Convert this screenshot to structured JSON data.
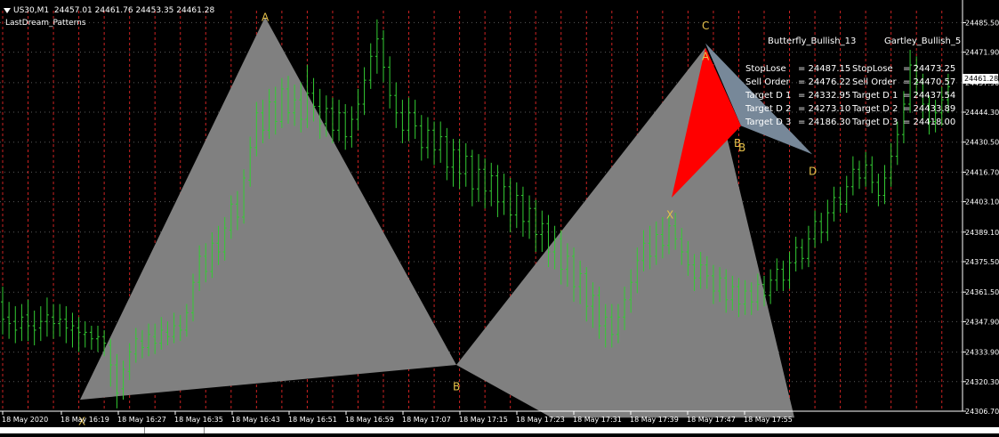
{
  "header": {
    "symbol": "US30,M1",
    "ohlc": "24457.01 24461.76 24453.35 24461.28",
    "indicator": "LastDream_Patterns"
  },
  "colors": {
    "background": "#000000",
    "candles": "#33cc33",
    "pattern_grey": "#808080",
    "pattern_red": "#ff0000",
    "pattern_slate": "#778899",
    "labels": "#e6c14a",
    "grid_v": "#cc2222",
    "grid_h": "#5a5a5a",
    "axis_text": "#ffffff"
  },
  "current_price_label": "24461.28",
  "panel": {
    "title_left": "Butterfly_Bullish_13",
    "title_right": "Gartley_Bullish_5",
    "rows": [
      {
        "l_label": "StopLose",
        "l_val": "= 24487.15",
        "r_label": "StopLose",
        "r_val": "= 24473.25"
      },
      {
        "l_label": "Sell Order",
        "l_val": "= 24476.22",
        "r_label": "Sell Order",
        "r_val": "= 24470.57"
      },
      {
        "l_label": "Target D 1",
        "l_val": "= 24332.95",
        "r_label": "Target D 1",
        "r_val": "= 24437.54"
      },
      {
        "l_label": "Target D 2",
        "l_val": "= 24273.10",
        "r_label": "Target D 2",
        "r_val": "= 24433.89"
      },
      {
        "l_label": "Target D 3",
        "l_val": "= 24186.30",
        "r_label": "Target D 3",
        "r_val": "= 24418.00"
      }
    ]
  },
  "chart_data": {
    "type": "candlestick",
    "symbol": "US30,M1",
    "ylim": [
      24306.7,
      24491.0
    ],
    "y_ticks": [
      "24485.50",
      "24471.90",
      "24457.90",
      "24444.30",
      "24430.50",
      "24416.70",
      "24403.10",
      "24389.10",
      "24375.50",
      "24361.50",
      "24347.90",
      "24333.90",
      "24320.30",
      "24306.70"
    ],
    "x_ticks": [
      "18 May 2020",
      "18 May 16:19",
      "18 May 16:27",
      "18 May 16:35",
      "18 May 16:43",
      "18 May 16:51",
      "18 May 16:59",
      "18 May 17:07",
      "18 May 17:15",
      "18 May 17:23",
      "18 May 17:31",
      "18 May 17:39",
      "18 May 17:47",
      "18 May 17:55"
    ],
    "grid": true,
    "bars": [
      [
        24357,
        24349,
        24364,
        24342
      ],
      [
        24350,
        24347,
        24357,
        24340
      ],
      [
        24348,
        24344,
        24355,
        24338
      ],
      [
        24345,
        24350,
        24356,
        24339
      ],
      [
        24351,
        24346,
        24358,
        24339
      ],
      [
        24346,
        24344,
        24353,
        24337
      ],
      [
        24345,
        24348,
        24355,
        24339
      ],
      [
        24348,
        24351,
        24359,
        24341
      ],
      [
        24350,
        24347,
        24356,
        24340
      ],
      [
        24347,
        24349,
        24356,
        24341
      ],
      [
        24349,
        24345,
        24355,
        24338
      ],
      [
        24344,
        24346,
        24352,
        24336
      ],
      [
        24345,
        24343,
        24350,
        24334
      ],
      [
        24342,
        24343,
        24348,
        24336
      ],
      [
        24343,
        24340,
        24346,
        24335
      ],
      [
        24340,
        24341,
        24346,
        24334
      ],
      [
        24341,
        24338,
        24344,
        24332
      ],
      [
        24337,
        24328,
        24340,
        24318
      ],
      [
        24328,
        24315,
        24333,
        24308
      ],
      [
        24317,
        24326,
        24330,
        24312
      ],
      [
        24325,
        24334,
        24338,
        24321
      ],
      [
        24333,
        24340,
        24345,
        24329
      ],
      [
        24339,
        24336,
        24344,
        24331
      ],
      [
        24336,
        24342,
        24347,
        24332
      ],
      [
        24341,
        24338,
        24347,
        24333
      ],
      [
        24338,
        24344,
        24350,
        24335
      ],
      [
        24343,
        24341,
        24348,
        24337
      ],
      [
        24341,
        24346,
        24352,
        24338
      ],
      [
        24346,
        24344,
        24351,
        24339
      ],
      [
        24344,
        24352,
        24356,
        24341
      ],
      [
        24352,
        24366,
        24370,
        24348
      ],
      [
        24366,
        24378,
        24383,
        24362
      ],
      [
        24378,
        24371,
        24384,
        24366
      ],
      [
        24371,
        24384,
        24389,
        24368
      ],
      [
        24384,
        24380,
        24392,
        24374
      ],
      [
        24380,
        24391,
        24396,
        24376
      ],
      [
        24390,
        24402,
        24406,
        24386
      ],
      [
        24402,
        24396,
        24408,
        24390
      ],
      [
        24396,
        24414,
        24418,
        24393
      ],
      [
        24413,
        24428,
        24433,
        24410
      ],
      [
        24428,
        24444,
        24449,
        24424
      ],
      [
        24444,
        24436,
        24450,
        24430
      ],
      [
        24436,
        24449,
        24455,
        24432
      ],
      [
        24449,
        24440,
        24456,
        24434
      ],
      [
        24440,
        24455,
        24460,
        24437
      ],
      [
        24455,
        24444,
        24461,
        24439
      ],
      [
        24444,
        24450,
        24457,
        24438
      ],
      [
        24450,
        24441,
        24458,
        24435
      ],
      [
        24441,
        24453,
        24466,
        24437
      ],
      [
        24453,
        24447,
        24460,
        24440
      ],
      [
        24447,
        24439,
        24455,
        24432
      ],
      [
        24439,
        24446,
        24452,
        24433
      ],
      [
        24446,
        24436,
        24451,
        24430
      ],
      [
        24436,
        24444,
        24450,
        24431
      ],
      [
        24444,
        24433,
        24448,
        24427
      ],
      [
        24433,
        24441,
        24447,
        24428
      ],
      [
        24441,
        24448,
        24455,
        24436
      ],
      [
        24448,
        24459,
        24465,
        24443
      ],
      [
        24459,
        24470,
        24476,
        24455
      ],
      [
        24470,
        24478,
        24487,
        24462
      ],
      [
        24478,
        24465,
        24482,
        24458
      ],
      [
        24465,
        24452,
        24470,
        24446
      ],
      [
        24452,
        24444,
        24458,
        24437
      ],
      [
        24444,
        24436,
        24450,
        24430
      ],
      [
        24436,
        24444,
        24451,
        24431
      ],
      [
        24444,
        24438,
        24450,
        24432
      ],
      [
        24438,
        24428,
        24443,
        24422
      ],
      [
        24428,
        24436,
        24442,
        24423
      ],
      [
        24436,
        24427,
        24440,
        24420
      ],
      [
        24427,
        24433,
        24440,
        24421
      ],
      [
        24433,
        24419,
        24437,
        24413
      ],
      [
        24419,
        24427,
        24432,
        24410
      ],
      [
        24427,
        24416,
        24432,
        24409
      ],
      [
        24416,
        24424,
        24430,
        24410
      ],
      [
        24424,
        24409,
        24427,
        24401
      ],
      [
        24409,
        24418,
        24425,
        24403
      ],
      [
        24418,
        24408,
        24423,
        24400
      ],
      [
        24408,
        24415,
        24421,
        24401
      ],
      [
        24415,
        24403,
        24420,
        24396
      ],
      [
        24403,
        24410,
        24416,
        24397
      ],
      [
        24410,
        24397,
        24414,
        24389
      ],
      [
        24397,
        24406,
        24412,
        24391
      ],
      [
        24406,
        24394,
        24410,
        24387
      ],
      [
        24394,
        24400,
        24406,
        24386
      ],
      [
        24400,
        24388,
        24404,
        24380
      ],
      [
        24388,
        24393,
        24399,
        24380
      ],
      [
        24393,
        24380,
        24397,
        24373
      ],
      [
        24380,
        24386,
        24392,
        24372
      ],
      [
        24386,
        24372,
        24390,
        24365
      ],
      [
        24372,
        24378,
        24384,
        24364
      ],
      [
        24378,
        24364,
        24382,
        24357
      ],
      [
        24364,
        24370,
        24376,
        24356
      ],
      [
        24370,
        24355,
        24373,
        24348
      ],
      [
        24355,
        24360,
        24366,
        24345
      ],
      [
        24360,
        24346,
        24364,
        24340
      ],
      [
        24346,
        24350,
        24356,
        24336
      ],
      [
        24350,
        24342,
        24356,
        24336
      ],
      [
        24342,
        24350,
        24356,
        24338
      ],
      [
        24350,
        24358,
        24364,
        24344
      ],
      [
        24358,
        24366,
        24372,
        24352
      ],
      [
        24366,
        24376,
        24382,
        24361
      ],
      [
        24376,
        24384,
        24390,
        24371
      ],
      [
        24384,
        24378,
        24392,
        24372
      ],
      [
        24378,
        24388,
        24394,
        24374
      ],
      [
        24388,
        24383,
        24396,
        24377
      ],
      [
        24383,
        24392,
        24397,
        24379
      ],
      [
        24392,
        24386,
        24398,
        24381
      ],
      [
        24386,
        24380,
        24391,
        24374
      ],
      [
        24380,
        24374,
        24385,
        24369
      ],
      [
        24374,
        24368,
        24379,
        24362
      ],
      [
        24368,
        24374,
        24380,
        24363
      ],
      [
        24374,
        24369,
        24378,
        24363
      ],
      [
        24369,
        24362,
        24374,
        24356
      ],
      [
        24362,
        24368,
        24373,
        24357
      ],
      [
        24368,
        24358,
        24372,
        24352
      ],
      [
        24358,
        24364,
        24369,
        24353
      ],
      [
        24364,
        24356,
        24368,
        24350
      ],
      [
        24356,
        24362,
        24367,
        24351
      ],
      [
        24362,
        24357,
        24366,
        24351
      ],
      [
        24357,
        24365,
        24370,
        24353
      ],
      [
        24365,
        24360,
        24369,
        24355
      ],
      [
        24360,
        24367,
        24372,
        24356
      ],
      [
        24367,
        24372,
        24377,
        24362
      ],
      [
        24372,
        24367,
        24376,
        24362
      ],
      [
        24367,
        24375,
        24380,
        24363
      ],
      [
        24375,
        24382,
        24387,
        24371
      ],
      [
        24382,
        24377,
        24386,
        24372
      ],
      [
        24377,
        24386,
        24392,
        24373
      ],
      [
        24386,
        24394,
        24399,
        24382
      ],
      [
        24394,
        24389,
        24398,
        24384
      ],
      [
        24389,
        24398,
        24404,
        24385
      ],
      [
        24398,
        24405,
        24410,
        24394
      ],
      [
        24405,
        24402,
        24410,
        24398
      ],
      [
        24402,
        24410,
        24415,
        24398
      ],
      [
        24410,
        24418,
        24424,
        24406
      ],
      [
        24418,
        24414,
        24422,
        24409
      ],
      [
        24414,
        24420,
        24426,
        24410
      ],
      [
        24420,
        24412,
        24424,
        24407
      ],
      [
        24412,
        24406,
        24416,
        24401
      ],
      [
        24406,
        24414,
        24420,
        24402
      ],
      [
        24414,
        24424,
        24430,
        24410
      ],
      [
        24424,
        24434,
        24440,
        24420
      ],
      [
        24434,
        24448,
        24454,
        24430
      ],
      [
        24448,
        24466,
        24473,
        24444
      ],
      [
        24466,
        24458,
        24470,
        24452
      ],
      [
        24458,
        24448,
        24462,
        24441
      ],
      [
        24448,
        24440,
        24452,
        24434
      ],
      [
        24440,
        24444,
        24450,
        24435
      ],
      [
        24444,
        24450,
        24456,
        24438
      ],
      [
        24450,
        24456,
        24462,
        24444
      ]
    ],
    "patterns": [
      {
        "name": "Butterfly_Bullish_13",
        "points": {
          "X": 24312.0,
          "A": 24488.0,
          "B": 24328.0
        }
      },
      {
        "name": "Gartley_Bullish_5",
        "points": {
          "X": 24405.0,
          "A": 24474.0,
          "B": 24438.0,
          "C": 24476.0,
          "D": 24425.0
        }
      }
    ],
    "point_labels": [
      "X",
      "A",
      "B",
      "C",
      "B",
      "X",
      "A",
      "B",
      "D"
    ]
  }
}
